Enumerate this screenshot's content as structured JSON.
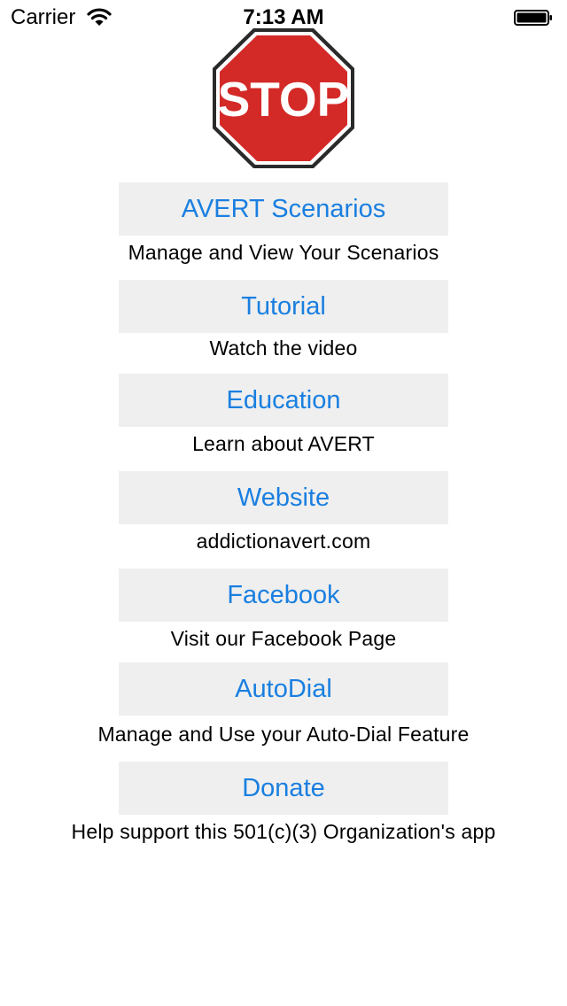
{
  "status_bar": {
    "carrier": "Carrier",
    "time": "7:13 AM",
    "wifi_icon": "wifi-icon",
    "battery_icon": "battery-icon"
  },
  "logo": {
    "text": "STOP",
    "color": "#d32a27"
  },
  "menu": {
    "accent_color": "#1a7fe0",
    "items": [
      {
        "label": "AVERT Scenarios",
        "caption": "Manage and View Your Scenarios"
      },
      {
        "label": "Tutorial",
        "caption": "Watch the video"
      },
      {
        "label": "Education",
        "caption": "Learn about AVERT"
      },
      {
        "label": "Website",
        "caption": "addictionavert.com"
      },
      {
        "label": "Facebook",
        "caption": "Visit our Facebook Page"
      },
      {
        "label": "AutoDial",
        "caption": "Manage and Use your Auto-Dial Feature"
      },
      {
        "label": "Donate",
        "caption": "Help support this 501(c)(3) Organization's app"
      }
    ]
  }
}
